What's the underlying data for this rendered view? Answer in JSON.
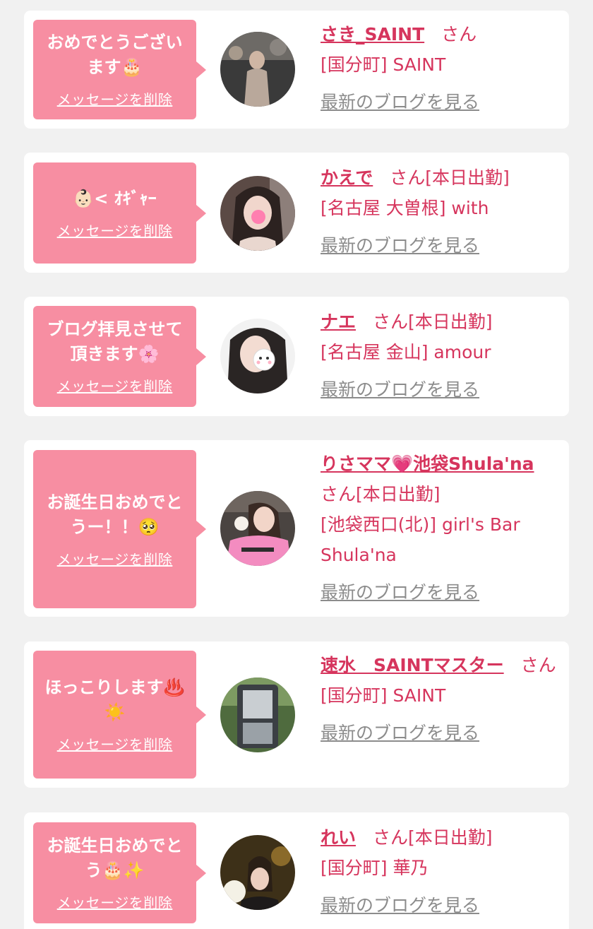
{
  "common": {
    "delete_label": "メッセージを削除",
    "blog_label": "最新のブログを見る",
    "honorific": "さん"
  },
  "colors": {
    "page_background": "#f1f1f1",
    "bubble": "#f78ea2",
    "accent_text": "#d6355d",
    "link_gray": "#8c8c8c"
  },
  "cards": [
    {
      "message": "おめでとうございます🎂",
      "name": "さき_SAINT",
      "status": "",
      "shop": "[国分町] SAINT"
    },
    {
      "message": "👶🏻< ｵｷﾞｬｰ",
      "name": "かえで",
      "status": "[本日出勤]",
      "shop": "[名古屋 大曽根] with"
    },
    {
      "message": "ブログ拝見させて頂きます🌸",
      "name": "ナエ",
      "status": "[本日出勤]",
      "shop": "[名古屋 金山] amour"
    },
    {
      "message": "お誕生日おめでとうー！！🥺",
      "name": "りさママ💗池袋Shula'na",
      "status": "[本日出勤]",
      "shop": "[池袋西口(北)] girl's Bar Shula'na"
    },
    {
      "message": "ほっこりします♨️☀️",
      "name": "速水　SAINTマスター",
      "status": "",
      "shop": "[国分町] SAINT"
    },
    {
      "message": "お誕生日おめでとう🎂✨",
      "name": "れい",
      "status": "[本日出勤]",
      "shop": "[国分町] 華乃"
    }
  ]
}
